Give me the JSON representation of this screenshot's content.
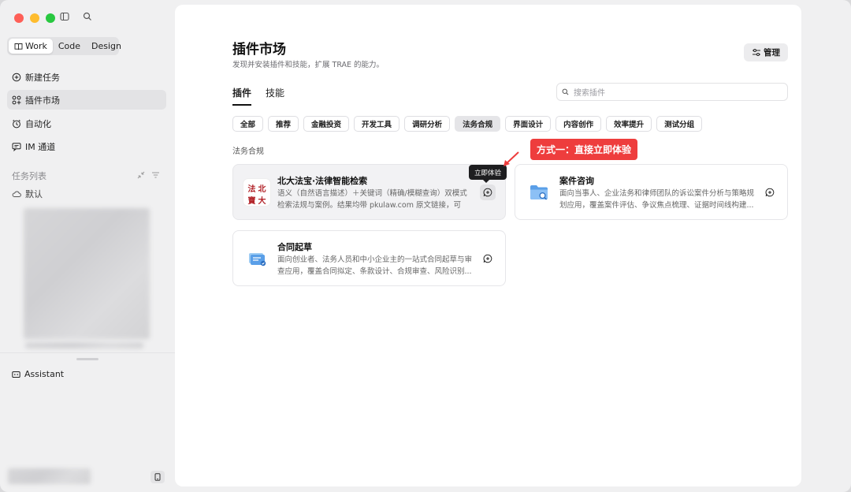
{
  "sidebar": {
    "modes": [
      {
        "label": "Work",
        "active": true
      },
      {
        "label": "Code",
        "active": false
      },
      {
        "label": "Design",
        "active": false
      }
    ],
    "nav": [
      {
        "label": "新建任务",
        "icon": "plus-circle-icon",
        "active": false
      },
      {
        "label": "插件市场",
        "icon": "grid-plugins-icon",
        "active": true
      },
      {
        "label": "自动化",
        "icon": "clock-icon",
        "active": false
      },
      {
        "label": "IM 通道",
        "icon": "chat-icon",
        "active": false
      }
    ],
    "tasks_section_title": "任务列表",
    "default_item": "默认",
    "assistant_label": "Assistant"
  },
  "main": {
    "title": "插件市场",
    "subtitle": "发现并安装插件和技能，扩展 TRAE 的能力。",
    "manage_label": "管理",
    "tabs": [
      {
        "label": "插件",
        "active": true
      },
      {
        "label": "技能",
        "active": false
      }
    ],
    "search_placeholder": "搜索插件",
    "filters": [
      {
        "label": "全部",
        "active": false
      },
      {
        "label": "推荐",
        "active": false
      },
      {
        "label": "金融投资",
        "active": false
      },
      {
        "label": "开发工具",
        "active": false
      },
      {
        "label": "调研分析",
        "active": false
      },
      {
        "label": "法务合规",
        "active": true
      },
      {
        "label": "界面设计",
        "active": false
      },
      {
        "label": "内容创作",
        "active": false
      },
      {
        "label": "效率提升",
        "active": false
      },
      {
        "label": "测试分组",
        "active": false
      }
    ],
    "category_label": "法务合规",
    "cards": [
      {
        "title": "北大法宝·法律智能检索",
        "desc": "语义（自然语言描述）＋关键词（精确/模糊查询）双模式检索法规与案例。结果均带 pkulaw.com 原文链接，可追...",
        "logo_chars": [
          "法",
          "北",
          "寶",
          "大"
        ]
      },
      {
        "title": "案件咨询",
        "desc": "面向当事人、企业法务和律师团队的诉讼案件分析与策略规划应用，覆盖案件评估、争议焦点梳理、证据时间线构建..."
      },
      {
        "title": "合同起草",
        "desc": "面向创业者、法务人员和中小企业主的一站式合同起草与审查应用，覆盖合同拟定、条款设计、合规审查、风险识别..."
      }
    ],
    "tooltip": "立即体验",
    "annotation": "方式一：直接立即体验"
  },
  "colors": {
    "accent_red": "#ee3d3d",
    "seal_red": "#b01e24",
    "folder_blue": "#5a9fe8"
  }
}
